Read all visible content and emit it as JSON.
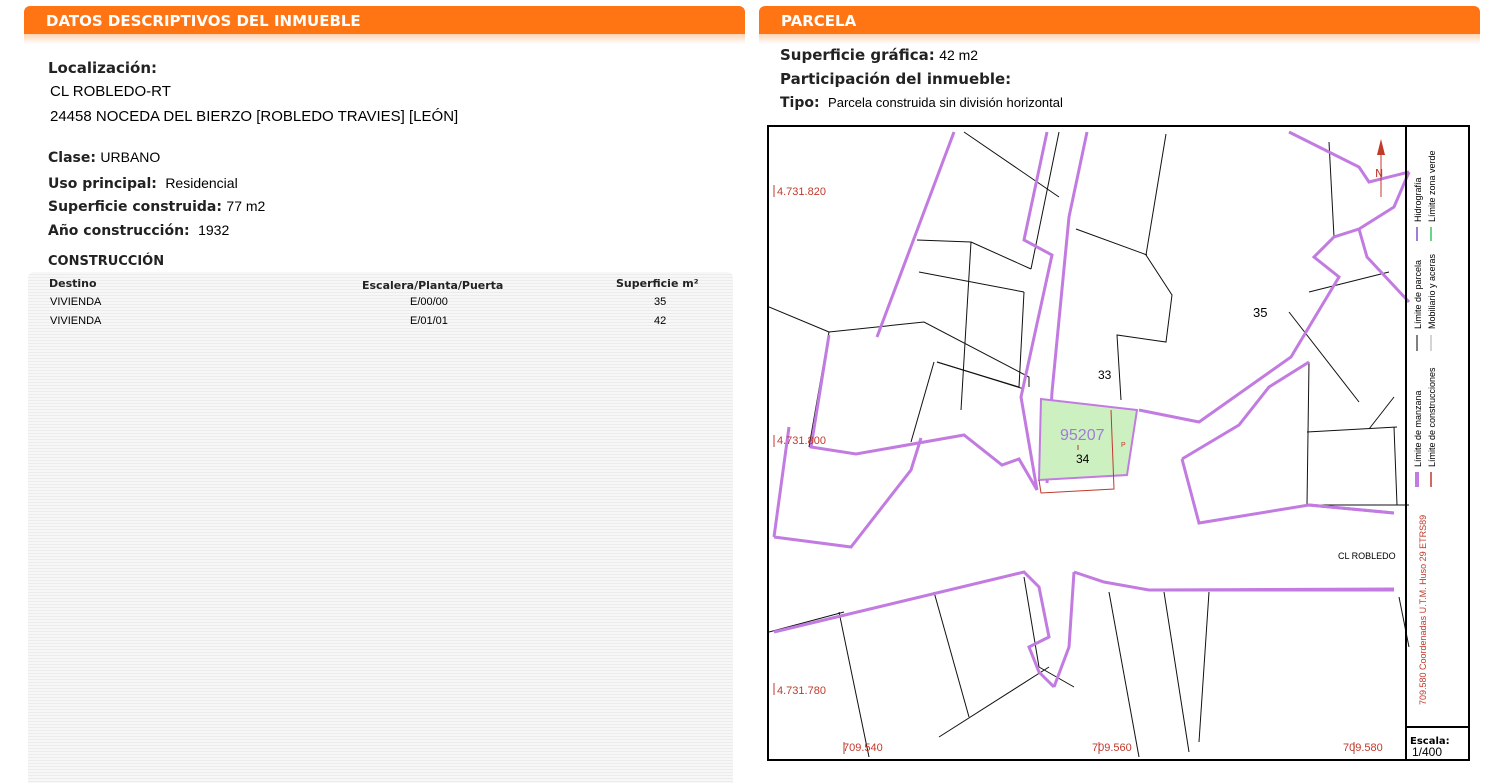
{
  "left_panel": {
    "title": "DATOS DESCRIPTIVOS DEL INMUEBLE",
    "localizacion_label": "Localización:",
    "address_line1": "CL ROBLEDO-RT",
    "address_line2": "24458 NOCEDA DEL BIERZO [ROBLEDO TRAVIES] [LEÓN]",
    "clase_label": "Clase:",
    "clase_value": "URBANO",
    "uso_label": "Uso principal:",
    "uso_value": "Residencial",
    "superficie_label": "Superficie construida:",
    "superficie_value": "77 m2",
    "ano_label": "Año construcción:",
    "ano_value": "1932",
    "construccion_title": "CONSTRUCCIÓN",
    "table": {
      "headers": [
        "Destino",
        "Escalera/Planta/Puerta",
        "Superficie m²"
      ],
      "rows": [
        [
          "VIVIENDA",
          "E/00/00",
          "35"
        ],
        [
          "VIVIENDA",
          "E/01/01",
          "42"
        ]
      ]
    }
  },
  "right_panel": {
    "title": "PARCELA",
    "sup_grafica_label": "Superficie gráfica:",
    "sup_grafica_value": "42 m2",
    "participacion_label": "Participación del inmueble:",
    "tipo_label": "Tipo:",
    "tipo_value": "Parcela construida sin división horizontal",
    "map": {
      "parcel_id": "95207",
      "parcel_number": "34",
      "neighbor_numbers": [
        "33",
        "35"
      ],
      "street_label": "CL ROBLEDO",
      "y_coords": [
        "4.731.820",
        "4.731.800",
        "4.731.780"
      ],
      "x_coords": [
        "709.540",
        "709.560",
        "709.580"
      ],
      "legend": {
        "manzana": "Límite de manzana",
        "construcciones": "Límite de construcciones",
        "parcela": "Límite de parcela",
        "mobiliario": "Mobiliario y aceras",
        "hidrografia": "Hidrografía",
        "zona_verde": "Límite zona verde",
        "coordinates": "709.580 Coordenadas U.T.M. Huso 29 ETRS89",
        "escala_label": "Escala:",
        "escala_value": "1/400"
      }
    }
  },
  "colors": {
    "header_orange": "#ff7514",
    "manzana_purple": "#c27be0",
    "construccion_red": "#c0392b",
    "parcel_fill": "#ccf0c0"
  }
}
